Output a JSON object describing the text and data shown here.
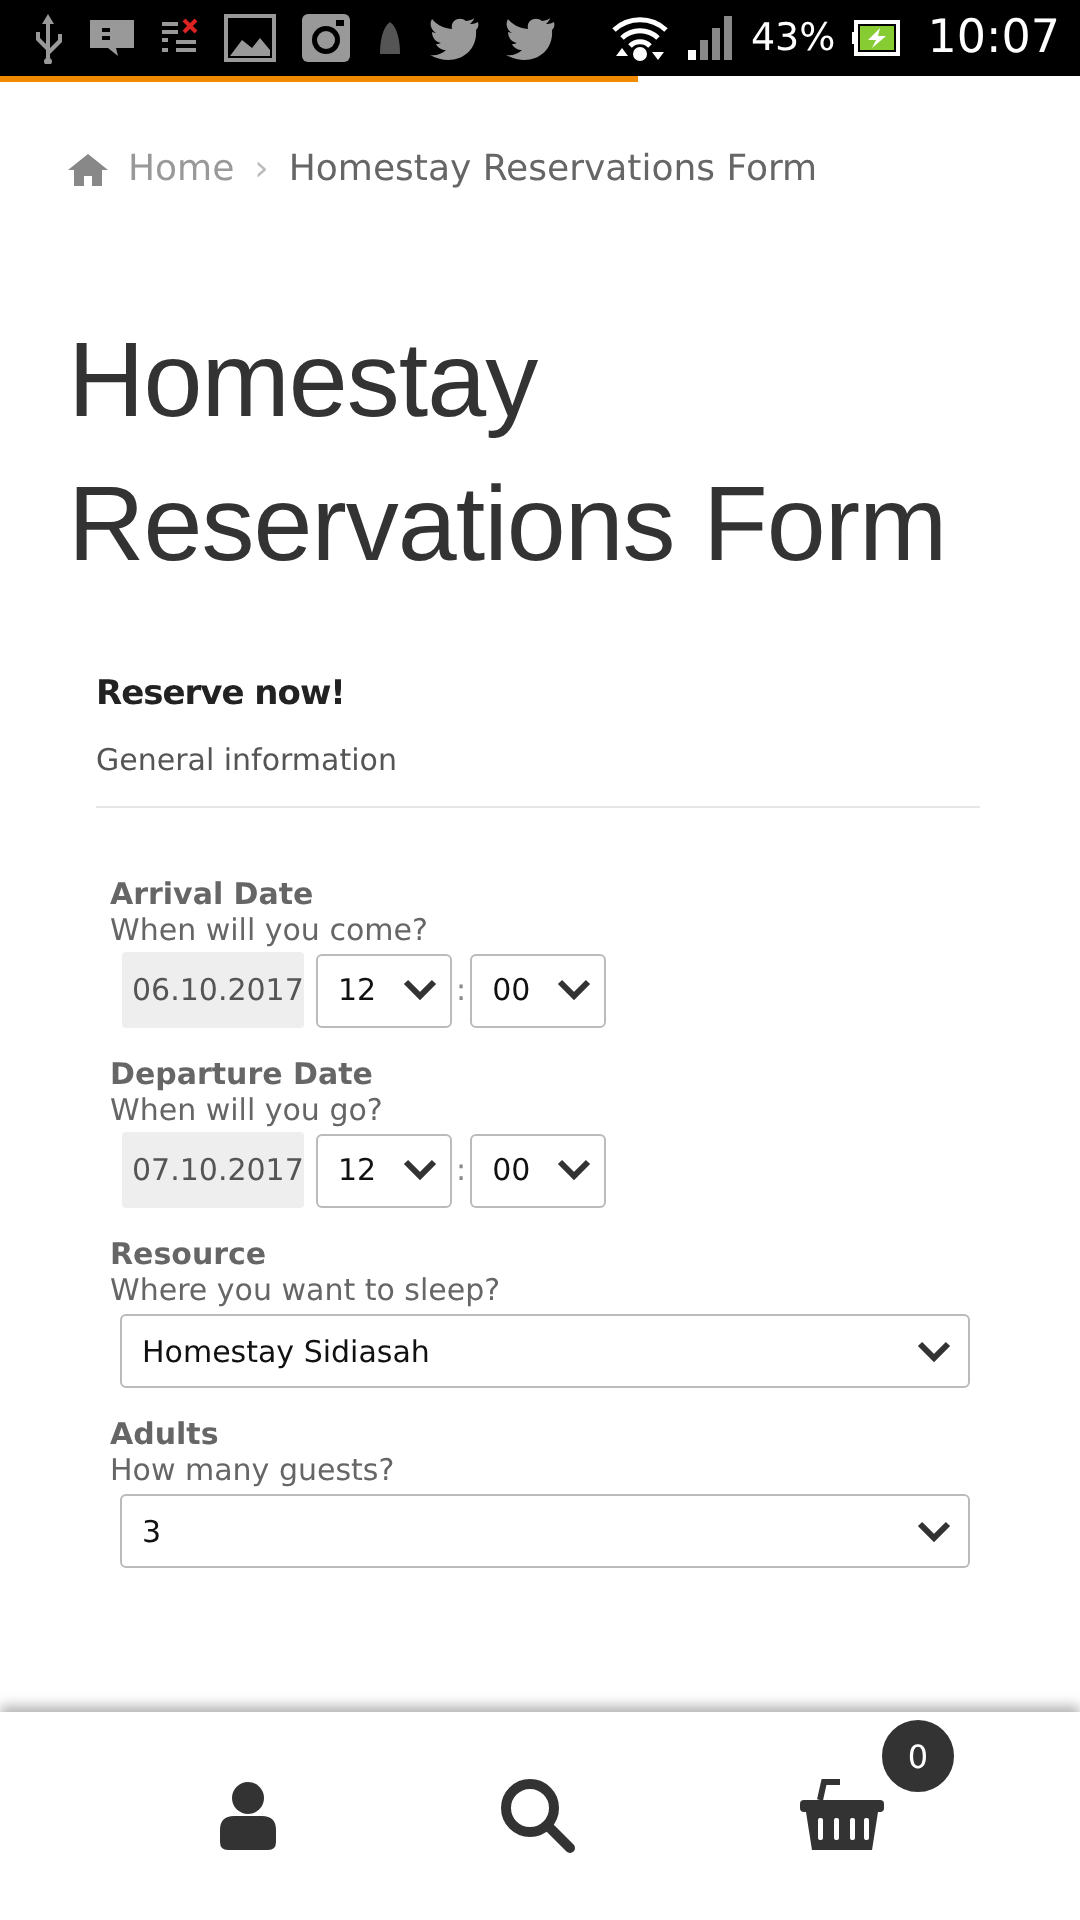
{
  "status_bar": {
    "battery": "43%",
    "time": "10:07"
  },
  "page_load": {
    "level": 0.59
  },
  "breadcrumb": {
    "home": "Home",
    "separator": "›",
    "current": "Homestay Reservations Form"
  },
  "title": "Homestay Reservations Form",
  "form": {
    "heading": "Reserve now!",
    "section": "General information",
    "fields": [
      {
        "kind": "datetime",
        "label": "Arrival Date",
        "hint": "When will you come?",
        "date": "06.10.2017",
        "hour": "12",
        "separator": ":",
        "minute": "00"
      },
      {
        "kind": "datetime",
        "label": "Departure Date",
        "hint": "When will you go?",
        "date": "07.10.2017",
        "hour": "12",
        "separator": ":",
        "minute": "00"
      },
      {
        "kind": "select",
        "label": "Resource",
        "hint": "Where you want to sleep?",
        "value": "Homestay Sidiasah"
      },
      {
        "kind": "select",
        "label": "Adults",
        "hint": "How many guests?",
        "value": "3"
      }
    ]
  },
  "bottom_nav": {
    "cart_count": "0"
  }
}
